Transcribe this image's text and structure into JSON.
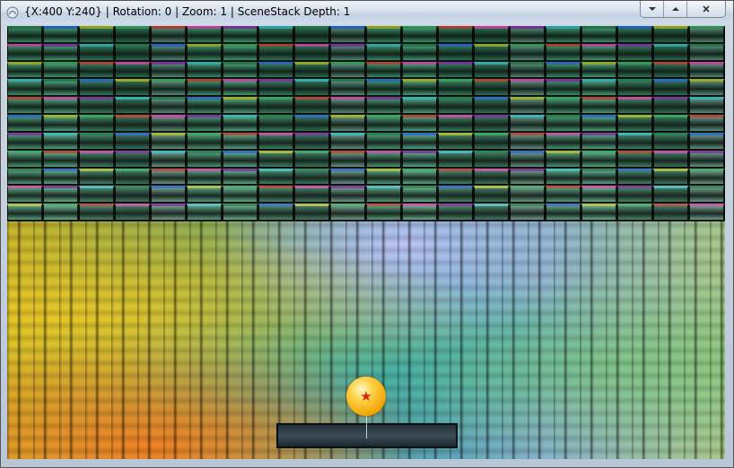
{
  "window": {
    "title": "{X:400 Y:240} | Rotation: 0 | Zoom: 1 | SceneStack Depth: 1"
  },
  "controls": {
    "minimize_icon": "minimize-icon",
    "maximize_icon": "maximize-icon",
    "close_icon": "close-icon"
  },
  "game": {
    "brick_rows": 11,
    "brick_columns": 20,
    "brick_stripe_colors": [
      "#2a7d4f",
      "#3aa060",
      "#7a3c9a",
      "#2f6cc0",
      "#b04a3a",
      "#3ab0b0",
      "#9ab030",
      "#c04fa0"
    ],
    "brick_body_colors": [
      "#3f8f6a",
      "#2f6f55",
      "#4a9c78",
      "#5b8b7a",
      "#357a5c"
    ],
    "ball_icon": "star-ball-icon",
    "accent": "#ffd24a"
  }
}
